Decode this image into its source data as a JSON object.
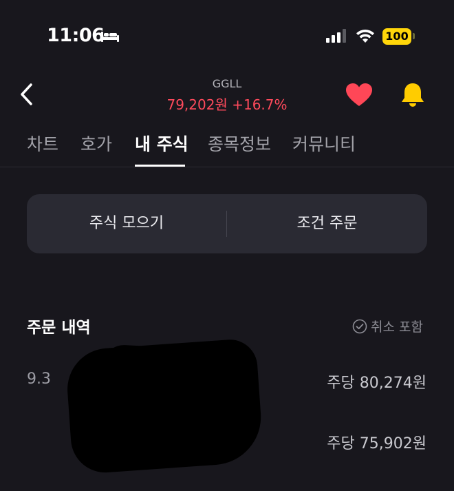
{
  "status_bar": {
    "time": "11:06",
    "battery": "100"
  },
  "header": {
    "ticker": "GGLL",
    "price": "79,202원",
    "change": "+16.7%",
    "price_color": "#ff4a5c"
  },
  "tabs": [
    {
      "label": "차트"
    },
    {
      "label": "호가"
    },
    {
      "label": "내 주식",
      "active": true
    },
    {
      "label": "종목정보"
    },
    {
      "label": "커뮤니티"
    }
  ],
  "segment": {
    "left_label": "주식 모으기",
    "right_label": "조건 주문"
  },
  "orders": {
    "title": "주문 내역",
    "filter_label": "취소 포함",
    "items": [
      {
        "date": "9.3",
        "price": "주당 80,274원"
      },
      {
        "date": "",
        "price": "주당 75,902원"
      }
    ]
  },
  "icons": {
    "back": "chevron-left-icon",
    "favorite": "heart-icon",
    "alert": "bell-icon",
    "accent_red": "#ff4757",
    "accent_yellow": "#ffcc00"
  }
}
